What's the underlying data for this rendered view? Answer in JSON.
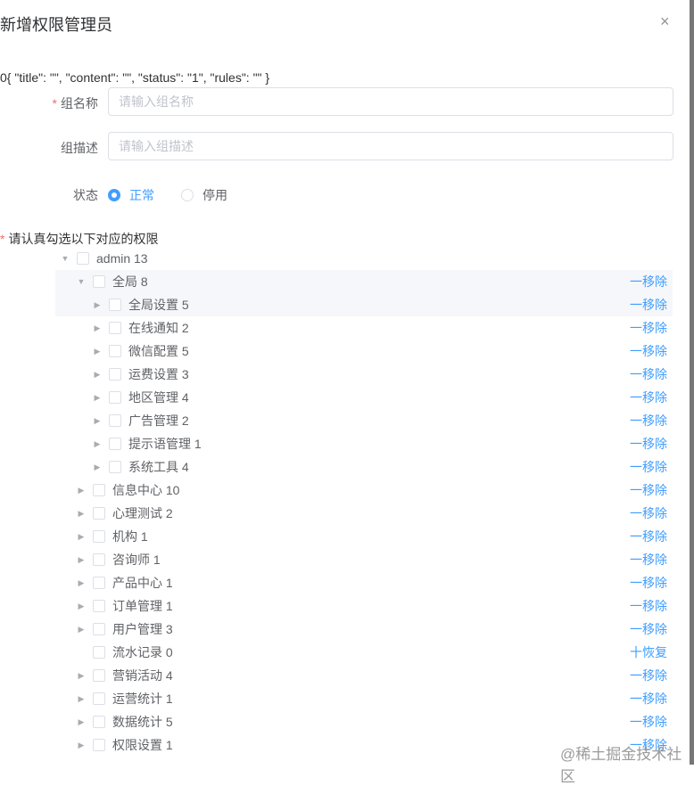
{
  "dialog": {
    "title": "新增权限管理员",
    "close_icon": "×"
  },
  "debug_text": "0{ \"title\": \"\", \"content\": \"\", \"status\": \"1\", \"rules\": \"\" }",
  "form": {
    "name_label": "组名称",
    "name_placeholder": "请输入组名称",
    "name_value": "",
    "desc_label": "组描述",
    "desc_placeholder": "请输入组描述",
    "desc_value": "",
    "status_label": "状态",
    "status_options": [
      "正常",
      "停用"
    ],
    "status_selected": 0,
    "required_mark": "*",
    "perm_label": "请认真勾选以下对应的权限"
  },
  "tree": [
    {
      "label": "admin 13",
      "level": 0,
      "arrow": "down",
      "action": ""
    },
    {
      "label": "全局 8",
      "level": 1,
      "arrow": "down",
      "action": "一移除",
      "highlight": true
    },
    {
      "label": "全局设置 5",
      "level": 2,
      "arrow": "right",
      "action": "一移除",
      "highlight": true
    },
    {
      "label": "在线通知 2",
      "level": 2,
      "arrow": "right",
      "action": "一移除"
    },
    {
      "label": "微信配置 5",
      "level": 2,
      "arrow": "right",
      "action": "一移除"
    },
    {
      "label": "运费设置 3",
      "level": 2,
      "arrow": "right",
      "action": "一移除"
    },
    {
      "label": "地区管理 4",
      "level": 2,
      "arrow": "right",
      "action": "一移除"
    },
    {
      "label": "广告管理 2",
      "level": 2,
      "arrow": "right",
      "action": "一移除"
    },
    {
      "label": "提示语管理 1",
      "level": 2,
      "arrow": "right",
      "action": "一移除"
    },
    {
      "label": "系统工具 4",
      "level": 2,
      "arrow": "right",
      "action": "一移除"
    },
    {
      "label": "信息中心 10",
      "level": 1,
      "arrow": "right",
      "action": "一移除"
    },
    {
      "label": "心理测试 2",
      "level": 1,
      "arrow": "right",
      "action": "一移除"
    },
    {
      "label": "机构 1",
      "level": 1,
      "arrow": "right",
      "action": "一移除"
    },
    {
      "label": "咨询师 1",
      "level": 1,
      "arrow": "right",
      "action": "一移除"
    },
    {
      "label": "产品中心 1",
      "level": 1,
      "arrow": "right",
      "action": "一移除"
    },
    {
      "label": "订单管理 1",
      "level": 1,
      "arrow": "right",
      "action": "一移除"
    },
    {
      "label": "用户管理 3",
      "level": 1,
      "arrow": "right",
      "action": "一移除"
    },
    {
      "label": "流水记录 0",
      "level": 1,
      "arrow": "none",
      "action": "十恢复"
    },
    {
      "label": "营销活动 4",
      "level": 1,
      "arrow": "right",
      "action": "一移除"
    },
    {
      "label": "运营统计 1",
      "level": 1,
      "arrow": "right",
      "action": "一移除"
    },
    {
      "label": "数据统计 5",
      "level": 1,
      "arrow": "right",
      "action": "一移除"
    },
    {
      "label": "权限设置 1",
      "level": 1,
      "arrow": "right",
      "action": "一移除"
    }
  ],
  "watermark": "@稀土掘金技术社区",
  "colors": {
    "primary": "#409eff",
    "danger": "#f56c6c"
  }
}
